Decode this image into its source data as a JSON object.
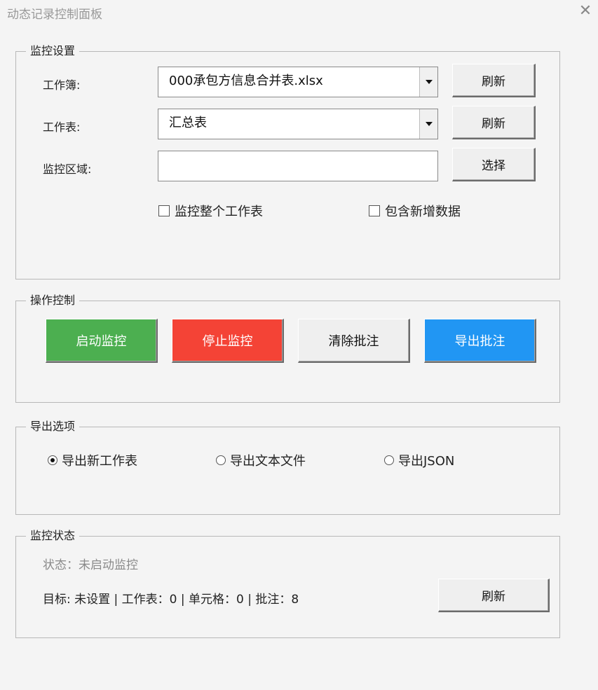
{
  "window": {
    "title": "动态记录控制面板",
    "close_icon": "close-icon"
  },
  "monitor_settings": {
    "legend": "监控设置",
    "workbook_label": "工作簿:",
    "workbook_value": "000承包方信息合并表.xlsx",
    "worksheet_label": "工作表:",
    "worksheet_value": "汇总表",
    "range_label": "监控区域:",
    "range_value": "",
    "refresh_label": "刷新",
    "select_label": "选择",
    "whole_sheet_label": "监控整个工作表",
    "whole_sheet_checked": false,
    "include_new_label": "包含新增数据",
    "include_new_checked": false
  },
  "operation_control": {
    "legend": "操作控制",
    "start_label": "启动监控",
    "stop_label": "停止监控",
    "clear_label": "清除批注",
    "export_label": "导出批注",
    "colors": {
      "start": "#4caf50",
      "stop": "#f44336",
      "export": "#2196f3"
    }
  },
  "export_options": {
    "legend": "导出选项",
    "options": [
      {
        "label": "导出新工作表",
        "selected": true
      },
      {
        "label": "导出文本文件",
        "selected": false
      },
      {
        "label": "导出JSON",
        "selected": false
      }
    ]
  },
  "monitor_status": {
    "legend": "监控状态",
    "state_text": "状态：未启动监控",
    "info_text": "目标: 未设置 | 工作表：0 | 单元格：0 | 批注：8",
    "refresh_label": "刷新"
  }
}
